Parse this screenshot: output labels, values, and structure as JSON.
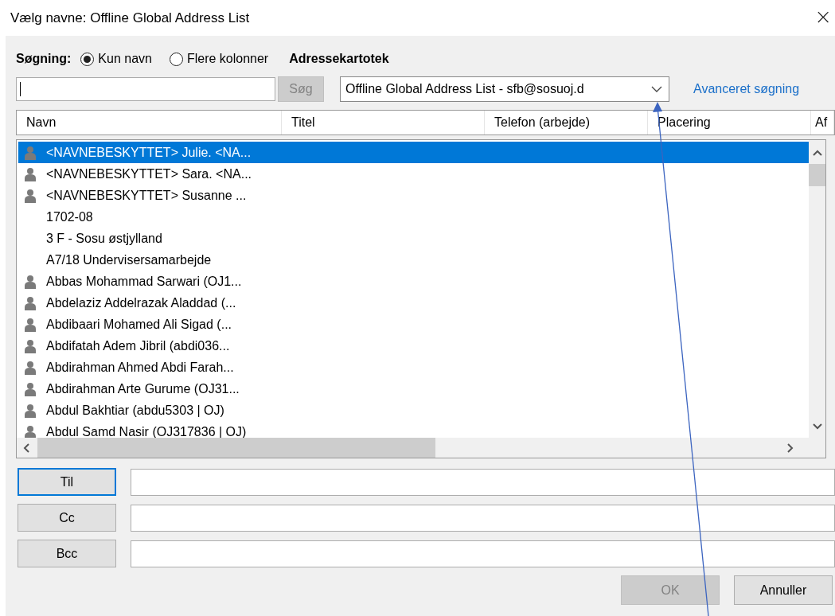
{
  "window": {
    "title": "Vælg navne: Offline Global Address List",
    "close": "×"
  },
  "search": {
    "label": "Søgning:",
    "modes": [
      {
        "label": "Kun navn",
        "selected": true
      },
      {
        "label": "Flere kolonner",
        "selected": false
      }
    ],
    "button": {
      "label": "Søg",
      "disabled": true
    }
  },
  "address_book": {
    "label": "Adressekartotek",
    "value": "Offline Global Address List - sfb@sosuoj.d",
    "advanced_link": "Avanceret søgning"
  },
  "table": {
    "columns": [
      "Navn",
      "Titel",
      "Telefon (arbejde)",
      "Placering",
      "Af"
    ],
    "rows": [
      {
        "name": "<NAVNEBESKYTTET> Julie. <NA...",
        "kind": "person",
        "selected": true
      },
      {
        "name": "<NAVNEBESKYTTET> Sara. <NA...",
        "kind": "person",
        "selected": false
      },
      {
        "name": "<NAVNEBESKYTTET> Susanne ...",
        "kind": "person",
        "selected": false
      },
      {
        "name": "1702-08",
        "kind": "plain",
        "selected": false
      },
      {
        "name": "3 F - Sosu østjylland",
        "kind": "plain",
        "selected": false
      },
      {
        "name": "A7/18 Undervisersamarbejde",
        "kind": "plain",
        "selected": false
      },
      {
        "name": "Abbas Mohammad Sarwari (OJ1...",
        "kind": "person",
        "selected": false
      },
      {
        "name": "Abdelaziz Addelrazak Aladdad (...",
        "kind": "person",
        "selected": false
      },
      {
        "name": "Abdibaari Mohamed Ali Sigad (...",
        "kind": "person",
        "selected": false
      },
      {
        "name": "Abdifatah Adem Jibril (abdi036...",
        "kind": "person",
        "selected": false
      },
      {
        "name": "Abdirahman Ahmed Abdi Farah...",
        "kind": "person",
        "selected": false
      },
      {
        "name": "Abdirahman Arte Gurume (OJ31...",
        "kind": "person",
        "selected": false
      },
      {
        "name": "Abdul Bakhtiar (abdu5303 | OJ)",
        "kind": "person",
        "selected": false
      },
      {
        "name": "Abdul Samd Nasir (OJ317836 | OJ)",
        "kind": "person",
        "selected": false
      }
    ]
  },
  "recipients": [
    {
      "label": "Til",
      "focused": true
    },
    {
      "label": "Cc",
      "focused": false
    },
    {
      "label": "Bcc",
      "focused": false
    }
  ],
  "buttons": [
    {
      "label": "OK",
      "disabled": true
    },
    {
      "label": "Annuller",
      "disabled": false
    }
  ]
}
